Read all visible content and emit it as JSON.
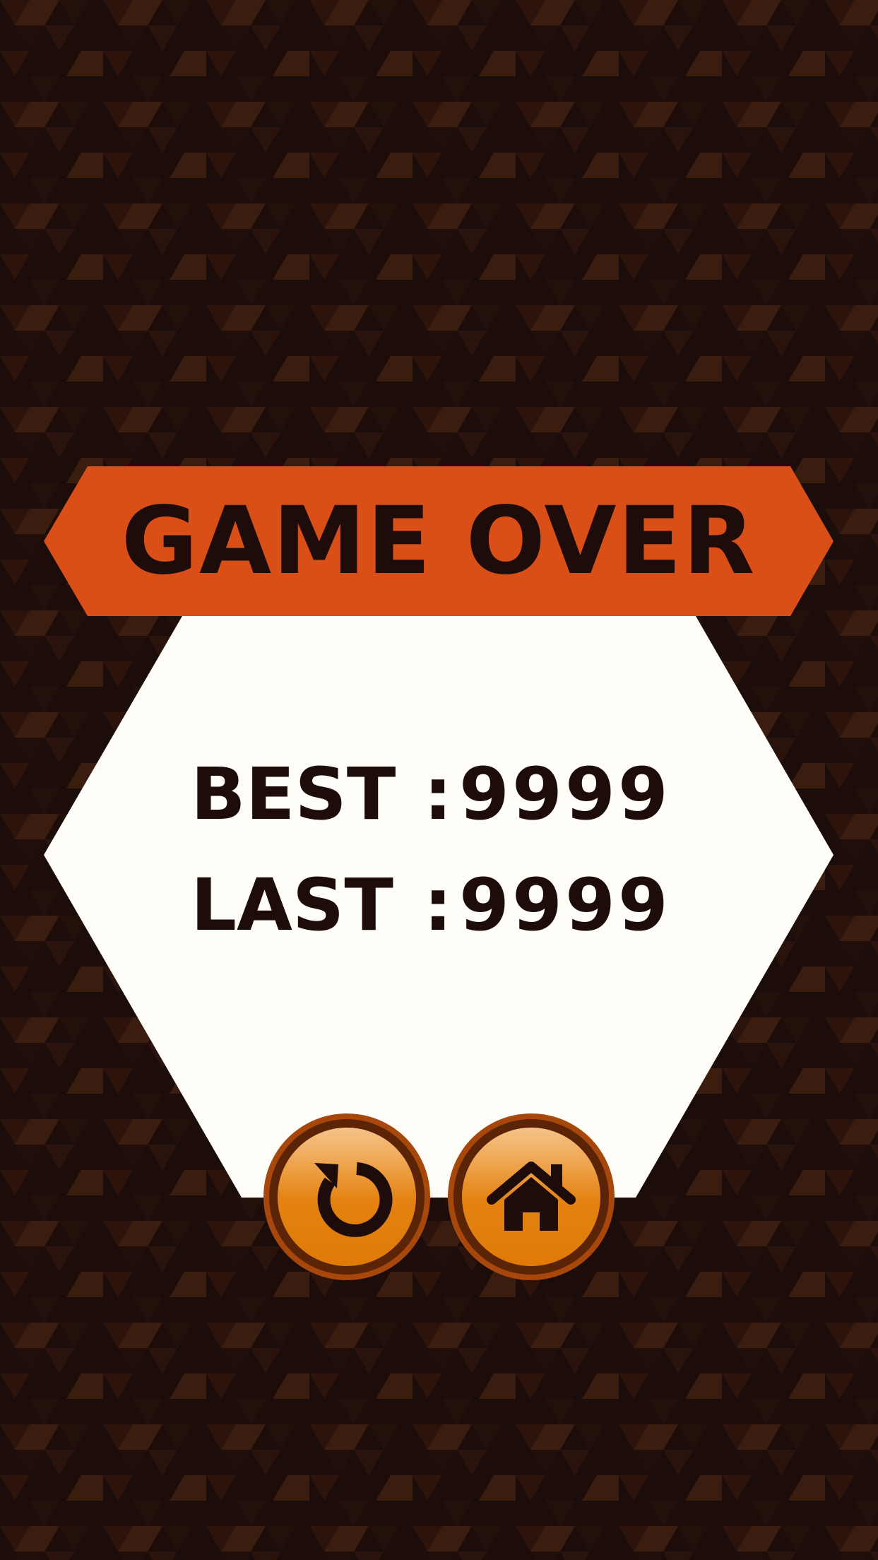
{
  "title": "GAME OVER",
  "scores": [
    {
      "label": "BEST",
      "separator": ":",
      "value": "9999"
    },
    {
      "label": "LAST",
      "separator": ":",
      "value": "9999"
    }
  ],
  "buttons": {
    "replay": {
      "icon": "replay-icon"
    },
    "home": {
      "icon": "home-icon"
    }
  },
  "colors": {
    "background_dark": "#1c0c0a",
    "background_mid": "#2a130c",
    "background_light": "#3a1c0e",
    "banner": "#d94f17",
    "panel": "#fefdf7",
    "text": "#1d0c0a",
    "button_orange": "#e48312"
  }
}
